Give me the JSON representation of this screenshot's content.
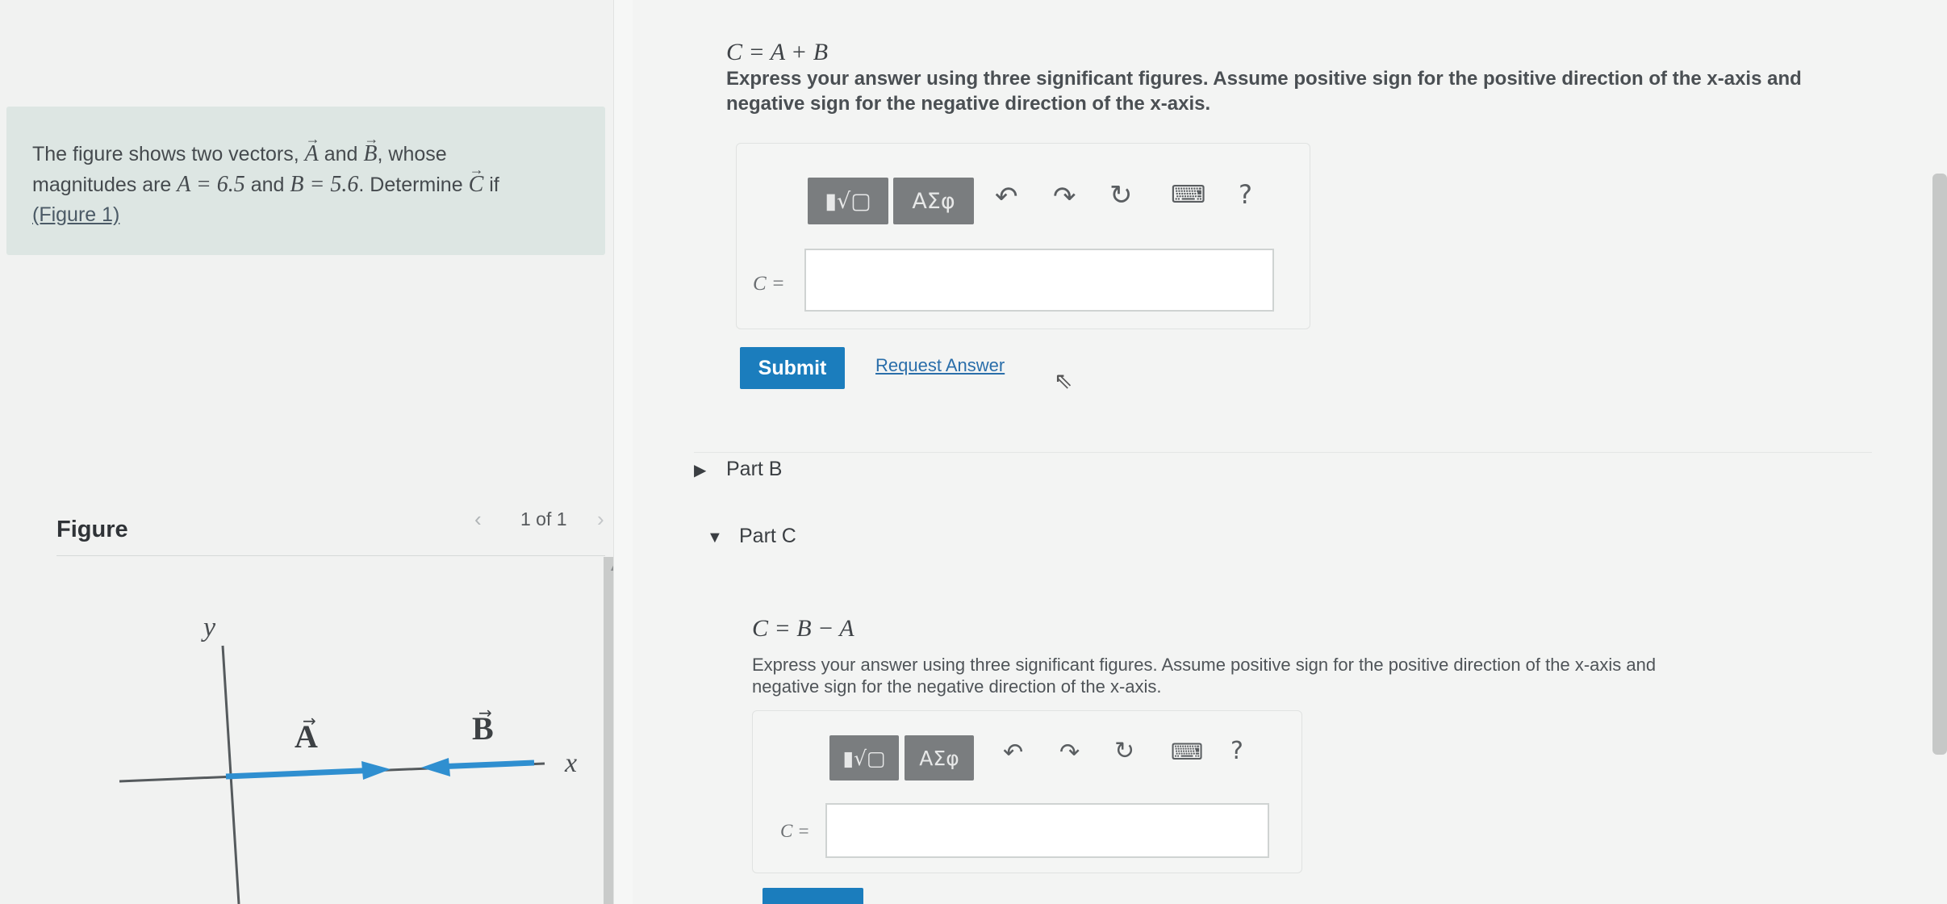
{
  "problem": {
    "intro": "The figure shows two vectors,",
    "vector_a": "A",
    "and_1": "and",
    "vector_b": "B",
    "whose": ", whose",
    "line2_pre": "magnitudes are",
    "a_eq": "A = 6.5",
    "and_2": "and",
    "b_eq": "B = 5.6",
    "determine": ". Determine",
    "vector_c": "C",
    "if": "if",
    "figure_link": "(Figure 1)"
  },
  "figure": {
    "title": "Figure",
    "pager": "1 of 1",
    "prev_icon": "chevron-left-icon",
    "next_icon": "chevron-right-icon",
    "axis_y": "y",
    "axis_x": "x",
    "label_a": "A",
    "label_b": "B",
    "vector_color": "#2f8fd0"
  },
  "part_a": {
    "formula": "C = A + B",
    "instructions_line1": "Express your answer using three significant figures. Assume positive sign for the positive direction of the x-axis and",
    "instructions_line2": "negative sign for the negative direction of the x-axis.",
    "toolbar": {
      "templates_label": "▮√▢",
      "greek_label": "ΑΣφ",
      "undo_icon": "undo-icon",
      "redo_icon": "redo-icon",
      "reset_icon": "reset-icon",
      "keyboard_icon": "keyboard-icon",
      "help_label": "?"
    },
    "answer_label": "C =",
    "answer_value": "",
    "submit_label": "Submit",
    "request_label": "Request Answer"
  },
  "part_b": {
    "label": "Part B"
  },
  "part_c": {
    "label": "Part C",
    "formula": "C = B − A",
    "instructions_line1": "Express your answer using three significant figures. Assume positive sign for the positive direction of the x-axis and",
    "instructions_line2": "negative sign for the negative direction of the x-axis.",
    "toolbar": {
      "templates_label": "▮√▢",
      "greek_label": "ΑΣφ",
      "help_label": "?"
    },
    "answer_label": "C =",
    "answer_value": ""
  },
  "colors": {
    "accent": "#1b7dbd",
    "problem_bg": "#dde6e3",
    "toolbar_btn": "#7a7d7f"
  }
}
